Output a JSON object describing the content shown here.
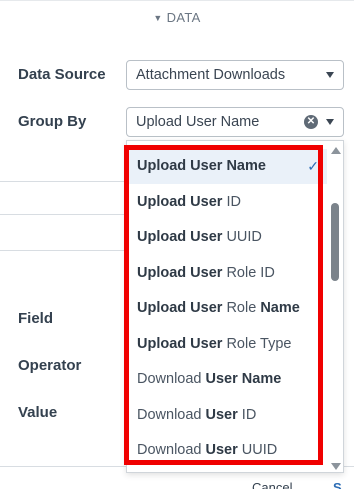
{
  "section": {
    "title": "DATA"
  },
  "data_source": {
    "label": "Data Source",
    "value": "Attachment Downloads"
  },
  "group_by": {
    "label": "Group By",
    "value": "Upload User Name",
    "options": [
      {
        "pre": "",
        "bold": "Upload User",
        "post": "",
        "bold2": " Name",
        "selected": true
      },
      {
        "pre": "",
        "bold": "Upload User",
        "post": " ID",
        "bold2": ""
      },
      {
        "pre": "",
        "bold": "Upload User",
        "post": " UUID",
        "bold2": ""
      },
      {
        "pre": "",
        "bold": "Upload User",
        "post": " Role ID",
        "bold2": ""
      },
      {
        "pre": "",
        "bold": "Upload User",
        "post": " Role ",
        "bold2": "Name"
      },
      {
        "pre": "",
        "bold": "Upload User",
        "post": " Role Type",
        "bold2": ""
      },
      {
        "pre": "Download ",
        "bold": "User Name",
        "post": "",
        "bold2": ""
      },
      {
        "pre": "Download ",
        "bold": "User",
        "post": " ID",
        "bold2": ""
      },
      {
        "pre": "Download ",
        "bold": "User",
        "post": " UUID",
        "bold2": ""
      }
    ]
  },
  "filter": {
    "field_label": "Field",
    "operator_label": "Operator",
    "value_label": "Value"
  },
  "footer": {
    "text": "Cancel",
    "link": "S"
  },
  "colors": {
    "highlight": "#f00000",
    "accent": "#2d6db5",
    "selected_bg": "#eaf1f9"
  },
  "icons": {
    "section_caret": "triangle-down-icon",
    "clear": "clear-circle-x-icon",
    "check": "checkmark-icon"
  }
}
